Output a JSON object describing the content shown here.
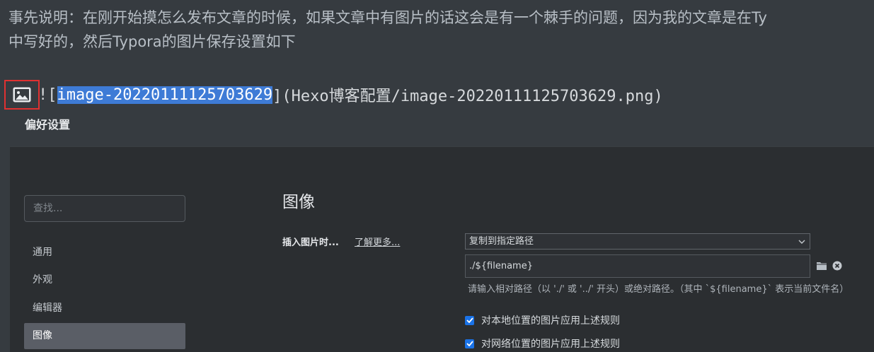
{
  "article": {
    "line1": "事先说明：在刚开始摸怎么发布文章的时候，如果文章中有图片的话这会是有一个棘手的问题，因为我的文章是在Ty",
    "line2": "中写好的，然后Typora的图片保存设置如下"
  },
  "markdown": {
    "bang": "!",
    "open_bracket": "[",
    "alt_text": "image-20220111125703629",
    "rest": "](Hexo博客配置/image-20220111125703629.png)"
  },
  "preferences": {
    "window_title": "偏好设置",
    "search": {
      "placeholder": "查找..."
    },
    "nav": [
      {
        "label": "通用"
      },
      {
        "label": "外观"
      },
      {
        "label": "编辑器"
      },
      {
        "label": "图像",
        "active": true
      }
    ],
    "section_title": "图像",
    "insert_label": "插入图片时...",
    "learn_more": "了解更多...",
    "insert_action": "复制到指定路径",
    "path_value": "./${filename}",
    "hint": "请输入相对路径（以 './' 或 '../' 开头）或绝对路径。（其中 `${filename}` 表示当前文件名）",
    "checkboxes": [
      {
        "label": "对本地位置的图片应用上述规则",
        "checked": true
      },
      {
        "label": "对网络位置的图片应用上述规则",
        "checked": true
      }
    ]
  },
  "colors": {
    "background": "#363b40",
    "pref_background": "#2b2e31",
    "selection": "#3e7bd6",
    "highlight_border": "#e03131",
    "checkbox": "#1a73e8"
  }
}
